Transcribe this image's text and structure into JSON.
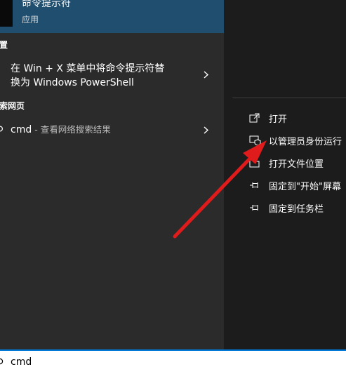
{
  "best_match": {
    "name": "命令提示符",
    "type": "应用"
  },
  "settings": {
    "header": "置",
    "item_line1": "在 Win + X 菜单中将命令提示符替",
    "item_line2": "换为 Windows PowerShell"
  },
  "web": {
    "header": "索网页",
    "query": "cmd",
    "suffix": " - 查看网络搜索结果"
  },
  "context_menu": {
    "items": [
      {
        "label": "打开",
        "icon": "open-icon"
      },
      {
        "label": "以管理员身份运行",
        "icon": "shield-icon"
      },
      {
        "label": "打开文件位置",
        "icon": "folder-icon"
      },
      {
        "label": "固定到\"开始\"屏幕",
        "icon": "pin-icon"
      },
      {
        "label": "固定到任务栏",
        "icon": "pin-icon"
      }
    ]
  },
  "search": {
    "value": "cmd"
  },
  "colors": {
    "accent": "#0078d7",
    "highlight": "#1f4e6e",
    "annotation": "#e01b1b"
  }
}
